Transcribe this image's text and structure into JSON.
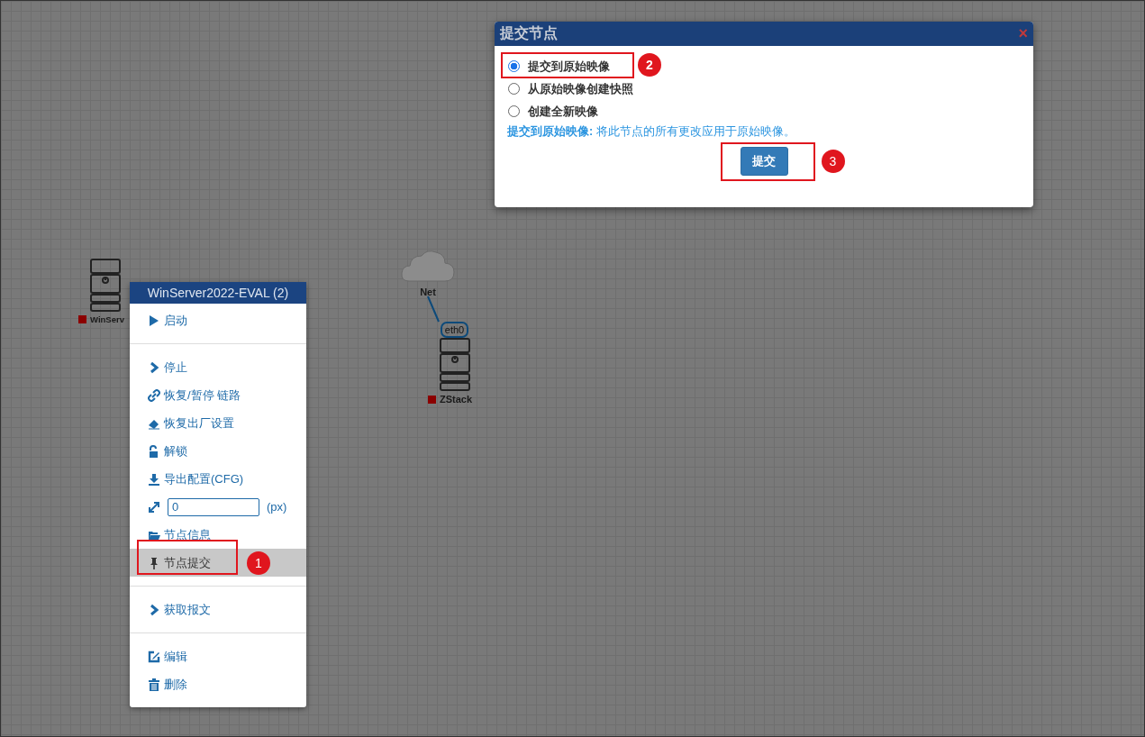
{
  "canvas": {
    "nodes": [
      {
        "kind": "server",
        "label": "WinServ",
        "color": "#8b0000"
      },
      {
        "kind": "cloud",
        "label": "Net"
      },
      {
        "kind": "server",
        "label": "ZStack",
        "color": "#8b0000",
        "interface": "eth0"
      }
    ]
  },
  "context_menu": {
    "title": "WinServer2022-EVAL (2)",
    "items": [
      {
        "kind": "action",
        "label": "启动",
        "selected": false
      },
      {
        "kind": "divider"
      },
      {
        "kind": "action",
        "label": "停止",
        "selected": false
      },
      {
        "kind": "action",
        "label": "恢复/暂停 链路",
        "selected": false
      },
      {
        "kind": "action",
        "label": "恢复出厂设置",
        "selected": false
      },
      {
        "kind": "action",
        "label": "解锁",
        "selected": false
      },
      {
        "kind": "action",
        "label": "导出配置(CFG)",
        "selected": false
      },
      {
        "kind": "size_input",
        "value": "0",
        "unit": "(px)"
      },
      {
        "kind": "action",
        "label": "节点信息",
        "selected": false
      },
      {
        "kind": "action",
        "label": "节点提交",
        "selected": true,
        "annotation": "1"
      },
      {
        "kind": "divider"
      },
      {
        "kind": "action",
        "label": "获取报文",
        "selected": false
      },
      {
        "kind": "divider"
      },
      {
        "kind": "action",
        "label": "编辑",
        "selected": false
      },
      {
        "kind": "action",
        "label": "删除",
        "selected": false
      }
    ]
  },
  "dialog": {
    "title": "提交节点",
    "close": "×",
    "options": [
      {
        "label": "提交到原始映像",
        "selected": true,
        "annotation": "2"
      },
      {
        "label": "从原始映像创建快照",
        "selected": false
      },
      {
        "label": "创建全新映像",
        "selected": false
      }
    ],
    "description": "**提交到原始映像:** 将此节点的所有更改应用于原始映像。",
    "button": {
      "label": "提交",
      "annotation": "3"
    }
  }
}
